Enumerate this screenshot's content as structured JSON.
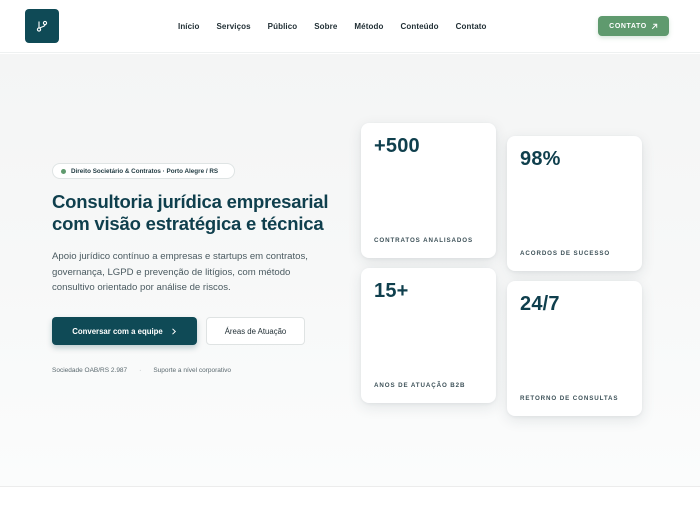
{
  "brand": {
    "logo_icon": "git-branch-icon",
    "logo_color": "#0f4a56"
  },
  "nav": {
    "items": [
      {
        "label": "Início"
      },
      {
        "label": "Serviços"
      },
      {
        "label": "Público"
      },
      {
        "label": "Sobre"
      },
      {
        "label": "Método"
      },
      {
        "label": "Conteúdo"
      },
      {
        "label": "Contato"
      }
    ],
    "cta_label": "CONTATO",
    "cta_icon": "arrow-up-right-icon",
    "cta_color": "#5f9a6e"
  },
  "hero": {
    "badge": "Direito Societário & Contratos · Porto Alegre / RS",
    "title_line1": "Consultoria jurídica empresarial",
    "title_line2": "com visão estratégica e técnica",
    "subtitle": "Apoio jurídico contínuo a empresas e startups em contratos, governança, LGPD e prevenção de litígios, com método consultivo orientado por análise de riscos.",
    "primary_button": "Conversar com a equipe",
    "primary_button_icon": "chevron-right-icon",
    "secondary_button": "Áreas de Atuação",
    "meta_left": "Sociedade OAB/RS 2.987",
    "meta_sep": "·",
    "meta_right": "Suporte a nível corporativo"
  },
  "stats": [
    {
      "value": "+500",
      "label": "CONTRATOS ANALISADOS"
    },
    {
      "value": "98%",
      "label": "ACORDOS DE SUCESSO"
    },
    {
      "value": "15+",
      "label": "ANOS DE ATUAÇÃO B2B"
    },
    {
      "value": "24/7",
      "label": "RETORNO DE CONSULTAS"
    }
  ]
}
